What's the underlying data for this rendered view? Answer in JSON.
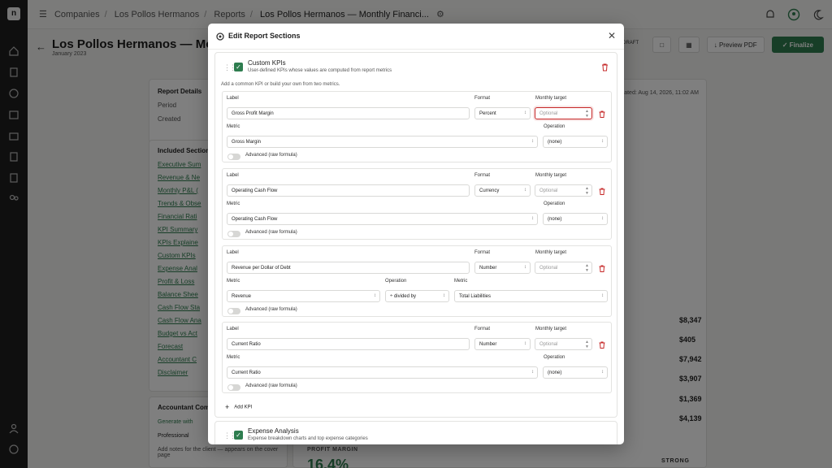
{
  "breadcrumb": {
    "items": [
      "Companies",
      "Los Pollos Hermanos",
      "Reports",
      "Los Pollos Hermanos — Monthly Financi..."
    ]
  },
  "page": {
    "title": "Los Pollos Hermanos — Month",
    "subtitle": "January 2023",
    "draft_badge": "DRAFT",
    "preview_label": "Preview PDF",
    "finalize_label": "Finalize",
    "generated": "erated: Aug 14, 2026, 11:02 AM"
  },
  "report_details": {
    "heading": "Report Details",
    "period_label": "Period",
    "created_label": "Created"
  },
  "included_sections": {
    "heading": "Included Section",
    "items": [
      "Executive Sum",
      "Revenue & Ne",
      "Monthly P&L (",
      "Trends & Obse",
      "Financial Rati",
      "KPI Summary",
      "KPIs Explaine",
      "Custom KPIs",
      "Expense Anal",
      "Profit & Loss",
      "Balance Shee",
      "Cash Flow Sta",
      "Cash Flow Ana",
      "Budget vs Act",
      "Forecast",
      "Accountant C",
      "Disclaimer"
    ]
  },
  "accountant": {
    "heading": "Accountant Com",
    "generate_label": "Generate with",
    "tone_label": "Professional",
    "note": "Add notes for the client — appears on the cover page"
  },
  "summary_values": [
    "$8,347",
    "$405",
    "$7,942",
    "$3,907",
    "$1,369",
    "$4,139"
  ],
  "profit_margin": {
    "label": "PROFIT MARGIN",
    "value": "16.4%",
    "rating": "STRONG"
  },
  "modal": {
    "title": "Edit Report Sections",
    "custom_kpis": {
      "title": "Custom KPIs",
      "description": "User-defined KPIs whose values are computed from report metrics",
      "hint": "Add a common KPI or build your own from two metrics.",
      "labels": {
        "label": "Label",
        "format": "Format",
        "target": "Monthly target",
        "metric": "Metric",
        "operation": "Operation",
        "advanced": "Advanced (raw formula)",
        "target_placeholder": "Optional"
      },
      "kpis": [
        {
          "label": "Gross Profit Margin",
          "format": "Percent",
          "metric": "Gross Margin",
          "operation": "(none)"
        },
        {
          "label": "Operating Cash Flow",
          "format": "Currency",
          "metric": "Operating Cash Flow",
          "operation": "(none)"
        },
        {
          "label": "Revenue per Dollar of Debt",
          "format": "Number",
          "metric": "Revenue",
          "operation": "÷ divided by",
          "metric2": "Total Liabilities"
        },
        {
          "label": "Current Ratio",
          "format": "Number",
          "metric": "Current Ratio",
          "operation": "(none)"
        }
      ],
      "add_label": "Add KPI"
    },
    "expense_analysis": {
      "title": "Expense Analysis",
      "description": "Expense breakdown charts and top expense categories"
    }
  }
}
